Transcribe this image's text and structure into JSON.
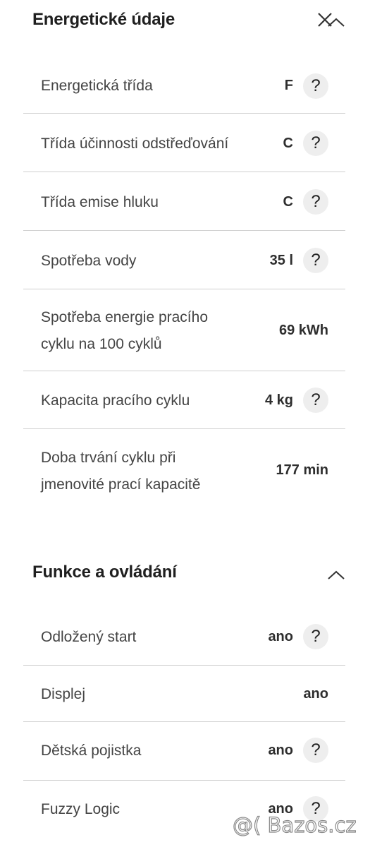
{
  "sections": [
    {
      "title": "Energetické údaje",
      "rows": [
        {
          "label": "Energetická třída",
          "value": "F",
          "help": "?"
        },
        {
          "label": "Třída účinnosti odstřeďování",
          "value": "C",
          "help": "?"
        },
        {
          "label": "Třída emise hluku",
          "value": "C",
          "help": "?"
        },
        {
          "label": "Spotřeba vody",
          "value": "35 l",
          "help": "?"
        },
        {
          "label_line1": "Spotřeba energie pracího",
          "label_line2": "cyklu na 100 cyklů",
          "value": "69 kWh"
        },
        {
          "label": "Kapacita pracího cyklu",
          "value": "4 kg",
          "help": "?"
        },
        {
          "label_line1": "Doba trvání cyklu při",
          "label_line2": "jmenovité prací kapacitě",
          "value": "177 min"
        }
      ]
    },
    {
      "title": "Funkce a ovládání",
      "rows": [
        {
          "label": "Odložený start",
          "value": "ano",
          "help": "?"
        },
        {
          "label": "Displej",
          "value": "ano"
        },
        {
          "label": "Dětská pojistka",
          "value": "ano",
          "help": "?"
        },
        {
          "label": "Fuzzy Logic",
          "value": "ano",
          "help": "?"
        }
      ]
    }
  ],
  "watermark": "@( Bazos.cz",
  "icons": {
    "close": "close-icon",
    "collapse": "chevron-up-icon",
    "help": "question-icon"
  }
}
